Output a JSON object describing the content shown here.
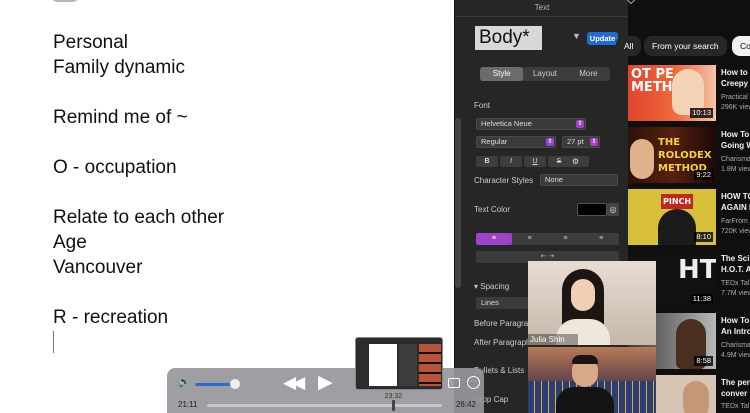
{
  "document": {
    "lines": [
      "Personal",
      "Family dynamic",
      "Remind me of ~",
      "O - occupation",
      "Relate to each other",
      "Age",
      "Vancouver",
      "R - recreation"
    ]
  },
  "inspector": {
    "title": "Text",
    "paragraph_style": "Body*",
    "update_label": "Update",
    "tabs": [
      "Style",
      "Layout",
      "More"
    ],
    "active_tab": "Style",
    "font_label": "Font",
    "font_family": "Helvetica Neue",
    "font_weight": "Regular",
    "font_size": "27 pt",
    "format_buttons": [
      "B",
      "I",
      "U",
      "S"
    ],
    "character_styles_label": "Character Styles",
    "character_styles_value": "None",
    "text_color_label": "Text Color",
    "text_color": "#000000",
    "spacing_label": "Spacing",
    "lines_value": "Lines",
    "before_paragraph_label": "Before Paragraph",
    "after_paragraph_label": "After Paragraph",
    "bullets_label": "Bullets & Lists",
    "drop_cap_label": "Drop Cap"
  },
  "youtube": {
    "chips": [
      "All",
      "From your search",
      "Co"
    ],
    "videos": [
      {
        "thumb_text": "OT PE METHOD",
        "duration": "10:13",
        "title": "How to",
        "title2": "Creepy",
        "channel": "Practical",
        "views": "296K views"
      },
      {
        "thumb_text": "THE ROLODEX METHOD",
        "duration": "9:22",
        "title": "How To",
        "title2": "Going W",
        "channel": "Charisma",
        "views": "1.8M views"
      },
      {
        "thumb_text": "PINCH",
        "duration": "8:10",
        "title": "HOW TO",
        "title2": "AGAIN I",
        "channel": "FarFrom",
        "views": "720K views"
      },
      {
        "thumb_text": "HT",
        "duration": "11:38",
        "title": "The Sci",
        "title2": "H.O.T. A",
        "channel": "TEDx Tal",
        "views": "7.7M views"
      },
      {
        "thumb_text": "",
        "duration": "8:58",
        "title": "How To",
        "title2": "An Intro",
        "channel": "Charisma",
        "views": "4.9M views"
      },
      {
        "thumb_text": "",
        "duration": "",
        "title": "The per",
        "title2": "conver",
        "channel": "TEDx Tal",
        "views": ""
      }
    ]
  },
  "facetime": {
    "caller1_name": "Julia Shin"
  },
  "player": {
    "current_time": "21:11",
    "end_time": "26:42",
    "hover_time": "23:32",
    "volume": 0.9,
    "progress": 0.79
  }
}
